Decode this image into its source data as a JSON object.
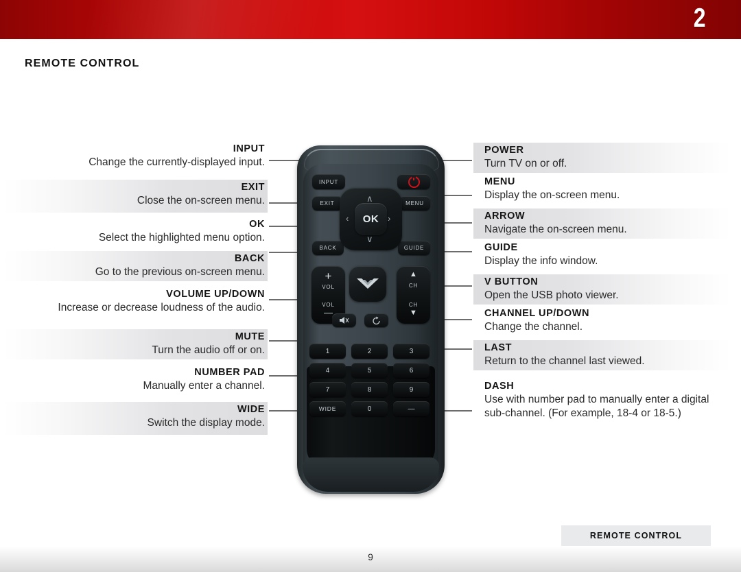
{
  "header": {
    "chapter_number": "2",
    "accent_color": "#c70808"
  },
  "section_title": "REMOTE CONTROL",
  "left_callouts": [
    {
      "title": "INPUT",
      "desc": "Change the currently-displayed input.",
      "shaded": false
    },
    {
      "title": "EXIT",
      "desc": "Close the on-screen menu.",
      "shaded": true
    },
    {
      "title": "OK",
      "desc": "Select the highlighted menu option.",
      "shaded": false
    },
    {
      "title": "BACK",
      "desc": "Go to the previous on-screen menu.",
      "shaded": true
    },
    {
      "title": "VOLUME UP/DOWN",
      "desc": "Increase or decrease loudness of the audio.",
      "shaded": false
    },
    {
      "title": "MUTE",
      "desc": "Turn the audio off or on.",
      "shaded": true
    },
    {
      "title": "NUMBER PAD",
      "desc": "Manually enter a channel.",
      "shaded": false
    },
    {
      "title": "WIDE",
      "desc": "Switch the display mode.",
      "shaded": true
    }
  ],
  "right_callouts": [
    {
      "title": "POWER",
      "desc": "Turn TV on or off.",
      "shaded": true
    },
    {
      "title": "MENU",
      "desc": "Display the on-screen menu.",
      "shaded": false
    },
    {
      "title": "ARROW",
      "desc": "Navigate the on-screen menu.",
      "shaded": true
    },
    {
      "title": "GUIDE",
      "desc": "Display the info window.",
      "shaded": false
    },
    {
      "title": "V BUTTON",
      "desc": "Open the USB photo viewer.",
      "shaded": true
    },
    {
      "title": "CHANNEL UP/DOWN",
      "desc": "Change the channel.",
      "shaded": false
    },
    {
      "title": "LAST",
      "desc": "Return to the channel last viewed.",
      "shaded": true
    },
    {
      "title": "DASH",
      "desc": "Use with number pad to manually enter a digital sub-channel. (For example, 18-4 or 18-5.)",
      "shaded": false
    }
  ],
  "remote": {
    "buttons": {
      "input": "INPUT",
      "exit": "EXIT",
      "back": "BACK",
      "power": "power-icon",
      "menu": "MENU",
      "guide": "GUIDE",
      "ok": "OK",
      "arrow_up": "∧",
      "arrow_down": "∨",
      "arrow_left": "‹",
      "arrow_right": "›",
      "vol_label_up": "VOL",
      "vol_label_down": "VOL",
      "vol_plus": "+",
      "vol_minus": "—",
      "ch_label_up": "CH",
      "ch_label_down": "CH",
      "ch_up": "▲",
      "ch_down": "▼",
      "v_button": "vizio-v-icon",
      "mute": "mute-icon",
      "last": "last-icon",
      "wide": "WIDE",
      "dash": "—"
    },
    "number_pad": [
      "1",
      "2",
      "3",
      "4",
      "5",
      "6",
      "7",
      "8",
      "9"
    ],
    "zero": "0"
  },
  "footer": {
    "tab_label": "REMOTE CONTROL",
    "page_number": "9"
  }
}
